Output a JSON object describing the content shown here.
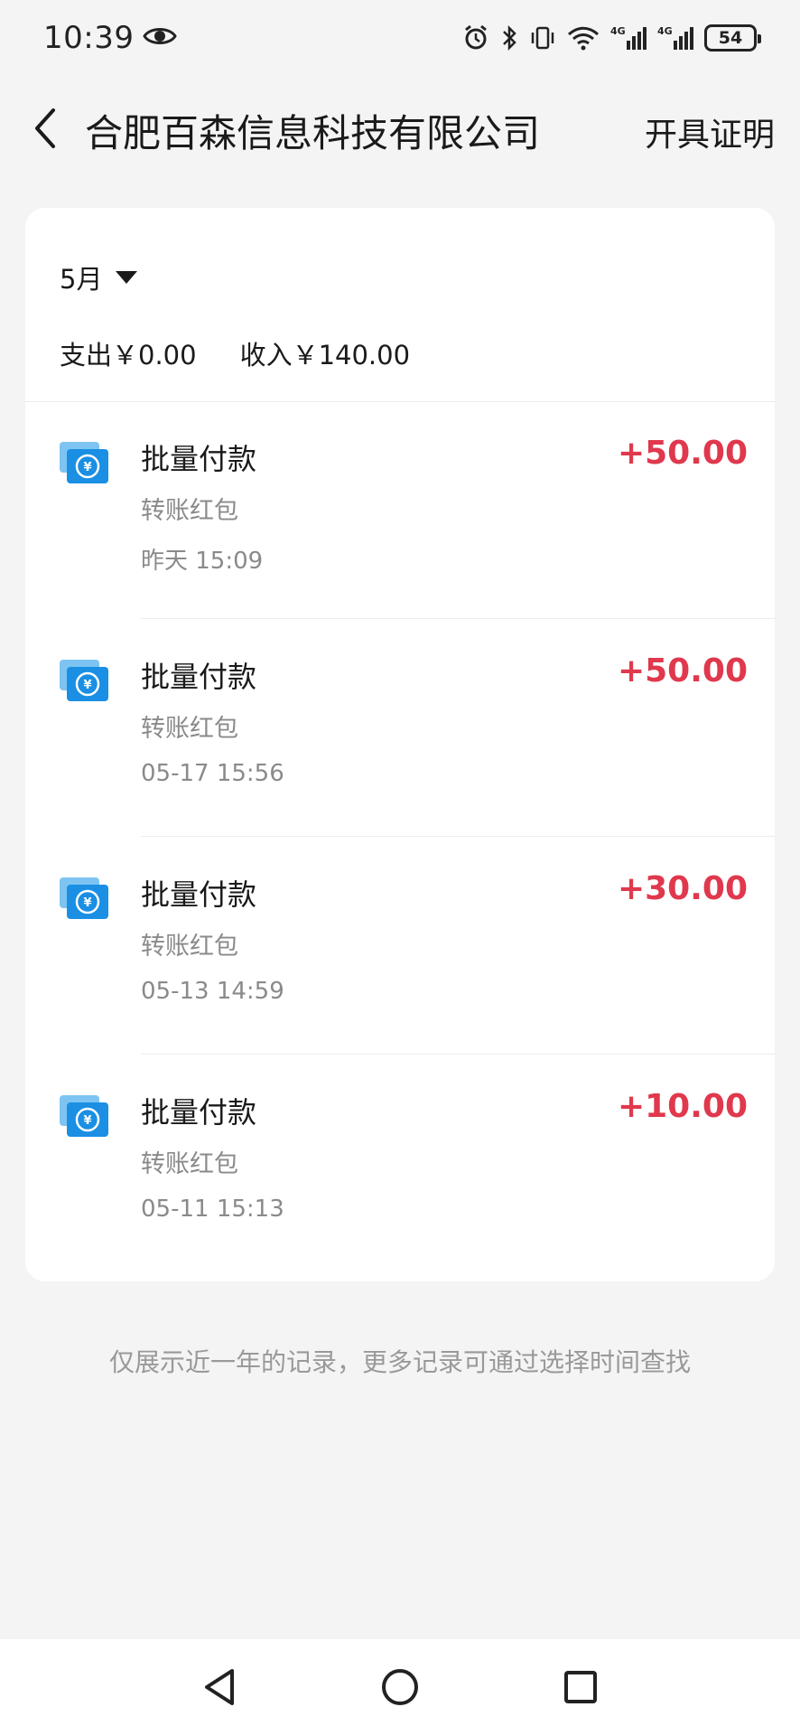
{
  "status_bar": {
    "time": "10:39",
    "battery": "54",
    "icons": [
      "eye-icon",
      "alarm-icon",
      "bluetooth-icon",
      "vibrate-icon",
      "wifi-icon",
      "signal-4g-icon",
      "signal-4g-icon"
    ]
  },
  "header": {
    "title": "合肥百森信息科技有限公司",
    "action_label": "开具证明"
  },
  "filter": {
    "month_label": "5月"
  },
  "summary": {
    "expense": "支出￥0.00",
    "income": "收入￥140.00"
  },
  "transactions": [
    {
      "title": "批量付款",
      "subtitle": "转账红包",
      "time": "昨天 15:09",
      "amount": "+50.00"
    },
    {
      "title": "批量付款",
      "subtitle": "转账红包",
      "time": "05-17 15:56",
      "amount": "+50.00"
    },
    {
      "title": "批量付款",
      "subtitle": "转账红包",
      "time": "05-13 14:59",
      "amount": "+30.00"
    },
    {
      "title": "批量付款",
      "subtitle": "转账红包",
      "time": "05-11 15:13",
      "amount": "+10.00"
    }
  ],
  "footnote": "仅展示近一年的记录，更多记录可通过选择时间查找",
  "colors": {
    "amount": "#e0384d",
    "icon_blue": "#1a8fe3",
    "icon_light": "#7ec4f2"
  }
}
